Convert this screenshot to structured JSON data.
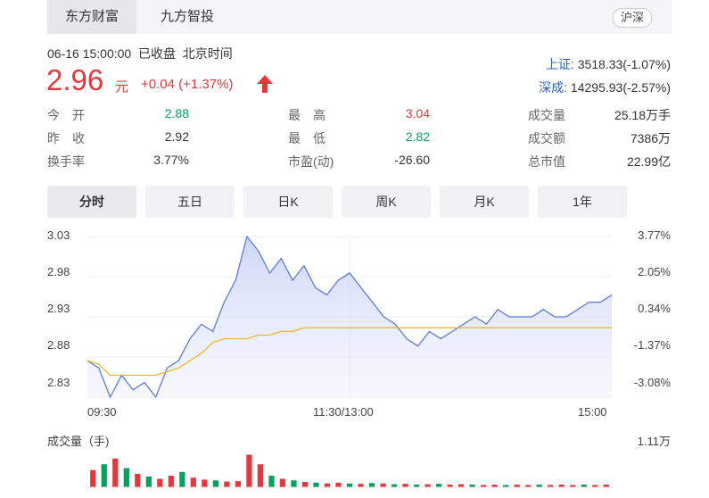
{
  "tabs": [
    {
      "label": "东方财富"
    },
    {
      "label": "九方智投"
    }
  ],
  "market_button": "沪深",
  "quote": {
    "datetime": "06-16 15:00:00",
    "status": "已收盘",
    "timezone": "北京时间",
    "price": "2.96",
    "unit": "元",
    "change": "+0.04 (+1.37%)"
  },
  "indices": [
    {
      "name": "上证:",
      "value": "3518.33(-1.07%)"
    },
    {
      "name": "深成:",
      "value": "14295.93(-2.57%)"
    }
  ],
  "stats_left": [
    {
      "label": "今　开",
      "value": "2.88",
      "color": "green"
    },
    {
      "label": "昨　收",
      "value": "2.92",
      "color": "normal"
    },
    {
      "label": "换手率",
      "value": "3.77%",
      "color": "normal"
    }
  ],
  "stats_mid": [
    {
      "label": "最　高",
      "value": "3.04",
      "color": "red"
    },
    {
      "label": "最　低",
      "value": "2.82",
      "color": "green"
    },
    {
      "label": "市盈(动)",
      "value": "-26.60",
      "color": "normal"
    }
  ],
  "stats_right": [
    {
      "label": "成交量",
      "value": "25.18万手"
    },
    {
      "label": "成交额",
      "value": "7386万"
    },
    {
      "label": "总市值",
      "value": "22.99亿"
    }
  ],
  "ranges": [
    {
      "label": "分时"
    },
    {
      "label": "五日"
    },
    {
      "label": "日K"
    },
    {
      "label": "周K"
    },
    {
      "label": "月K"
    },
    {
      "label": "1年"
    }
  ],
  "chart": {
    "y_left_ticks": [
      "3.03",
      "2.98",
      "2.93",
      "2.88",
      "2.83"
    ],
    "y_right_ticks": [
      "3.77%",
      "2.05%",
      "0.34%",
      "-1.37%",
      "-3.08%"
    ],
    "x_ticks": [
      "09:30",
      "11:30/13:00",
      "15:00"
    ],
    "volume_label": "成交量（手)",
    "volume_max": "1.11万"
  },
  "colors": {
    "red": "#e4393c",
    "green": "#08a05c",
    "price_line": "#5b7be0",
    "avg_line": "#f0b420",
    "link": "#2a64b7"
  },
  "chart_data": {
    "type": "line",
    "x_label": "",
    "y_label": "",
    "ylim": [
      2.82,
      3.04
    ],
    "prev_close": 2.92,
    "series": [
      {
        "values": [
          2.87,
          2.86,
          2.82,
          2.85,
          2.83,
          2.84,
          2.82,
          2.86,
          2.87,
          2.9,
          2.92,
          2.91,
          2.95,
          2.98,
          3.04,
          3.02,
          2.99,
          3.01,
          2.98,
          3.0,
          2.97,
          2.96,
          2.98,
          2.99,
          2.97,
          2.95,
          2.93,
          2.92,
          2.9,
          2.89,
          2.91,
          2.9,
          2.91,
          2.92,
          2.93,
          2.92,
          2.94,
          2.93,
          2.93,
          2.93,
          2.94,
          2.93,
          2.93,
          2.94,
          2.95,
          2.95,
          2.96
        ]
      },
      {
        "values": [
          2.87,
          2.865,
          2.85,
          2.85,
          2.85,
          2.85,
          2.85,
          2.855,
          2.86,
          2.87,
          2.88,
          2.895,
          2.9,
          2.9,
          2.9,
          2.905,
          2.905,
          2.91,
          2.91,
          2.915,
          2.915,
          2.915,
          2.915,
          2.915,
          2.915,
          2.915,
          2.915,
          2.915,
          2.915,
          2.915,
          2.915,
          2.915,
          2.915,
          2.915,
          2.915,
          2.915,
          2.915,
          2.915,
          2.915,
          2.915,
          2.915,
          2.915,
          2.915,
          2.915,
          2.915,
          2.915,
          2.915
        ]
      }
    ],
    "volumes": [
      {
        "v": 0.45,
        "c": "red"
      },
      {
        "v": 0.6,
        "c": "green"
      },
      {
        "v": 0.75,
        "c": "red"
      },
      {
        "v": 0.5,
        "c": "green"
      },
      {
        "v": 0.35,
        "c": "red"
      },
      {
        "v": 0.28,
        "c": "green"
      },
      {
        "v": 0.22,
        "c": "red"
      },
      {
        "v": 0.3,
        "c": "red"
      },
      {
        "v": 0.4,
        "c": "green"
      },
      {
        "v": 0.25,
        "c": "red"
      },
      {
        "v": 0.2,
        "c": "red"
      },
      {
        "v": 0.18,
        "c": "green"
      },
      {
        "v": 0.15,
        "c": "red"
      },
      {
        "v": 0.16,
        "c": "red"
      },
      {
        "v": 0.85,
        "c": "red"
      },
      {
        "v": 0.6,
        "c": "red"
      },
      {
        "v": 0.3,
        "c": "green"
      },
      {
        "v": 0.22,
        "c": "red"
      },
      {
        "v": 0.18,
        "c": "green"
      },
      {
        "v": 0.14,
        "c": "red"
      },
      {
        "v": 0.12,
        "c": "green"
      },
      {
        "v": 0.1,
        "c": "red"
      },
      {
        "v": 0.12,
        "c": "red"
      },
      {
        "v": 0.1,
        "c": "green"
      },
      {
        "v": 0.09,
        "c": "red"
      },
      {
        "v": 0.11,
        "c": "green"
      },
      {
        "v": 0.1,
        "c": "red"
      },
      {
        "v": 0.08,
        "c": "green"
      },
      {
        "v": 0.09,
        "c": "red"
      },
      {
        "v": 0.07,
        "c": "green"
      },
      {
        "v": 0.08,
        "c": "red"
      },
      {
        "v": 0.09,
        "c": "green"
      },
      {
        "v": 0.07,
        "c": "red"
      },
      {
        "v": 0.08,
        "c": "red"
      },
      {
        "v": 0.07,
        "c": "green"
      },
      {
        "v": 0.06,
        "c": "red"
      },
      {
        "v": 0.07,
        "c": "red"
      },
      {
        "v": 0.06,
        "c": "green"
      },
      {
        "v": 0.07,
        "c": "red"
      },
      {
        "v": 0.06,
        "c": "red"
      },
      {
        "v": 0.07,
        "c": "green"
      },
      {
        "v": 0.06,
        "c": "red"
      },
      {
        "v": 0.07,
        "c": "red"
      },
      {
        "v": 0.06,
        "c": "red"
      },
      {
        "v": 0.07,
        "c": "green"
      },
      {
        "v": 0.06,
        "c": "red"
      },
      {
        "v": 0.07,
        "c": "red"
      }
    ]
  }
}
